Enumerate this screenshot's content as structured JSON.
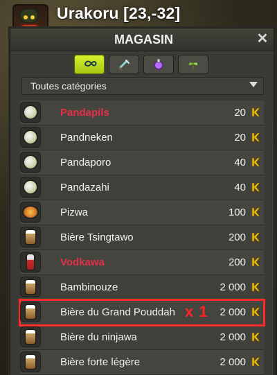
{
  "header": {
    "title": "Urakoru [23,-32]"
  },
  "store": {
    "window_title": "MAGASIN",
    "close_label": "✕",
    "category_select_value": "Toutes catégories",
    "filter_tabs": [
      {
        "icon": "infinity-icon",
        "active": true
      },
      {
        "icon": "sword-icon",
        "active": false
      },
      {
        "icon": "potion-icon",
        "active": false
      },
      {
        "icon": "plant-icon",
        "active": false
      }
    ]
  },
  "items": [
    {
      "name": "Pandapils",
      "price": "20",
      "icon": "panda-drink-icon",
      "highlight": true
    },
    {
      "name": "Pandneken",
      "price": "20",
      "icon": "panda-drink-icon",
      "highlight": false
    },
    {
      "name": "Pandaporo",
      "price": "40",
      "icon": "panda-drink-icon",
      "highlight": false
    },
    {
      "name": "Pandazahi",
      "price": "40",
      "icon": "panda-drink-icon",
      "highlight": false
    },
    {
      "name": "Pizwa",
      "price": "100",
      "icon": "pizza-icon",
      "highlight": false
    },
    {
      "name": "Bière Tsingtawo",
      "price": "200",
      "icon": "beer-icon",
      "highlight": false
    },
    {
      "name": "Vodkawa",
      "price": "200",
      "icon": "bottle-icon",
      "highlight": true
    },
    {
      "name": "Bambinouze",
      "price": "2 000",
      "icon": "beer-icon",
      "highlight": false
    },
    {
      "name": "Bière du Grand Pouddah",
      "price": "2 000",
      "icon": "beer-icon",
      "highlight": false,
      "selected": true,
      "quantity_label": "x 1"
    },
    {
      "name": "Bière du ninjawa",
      "price": "2 000",
      "icon": "beer-icon",
      "highlight": false
    },
    {
      "name": "Bière forte légère",
      "price": "2 000",
      "icon": "beer-icon",
      "highlight": false
    }
  ],
  "colors": {
    "highlight_text": "#e6304a",
    "selected_outline": "#ff2a2a",
    "kama_gold": "#f2c21b"
  }
}
